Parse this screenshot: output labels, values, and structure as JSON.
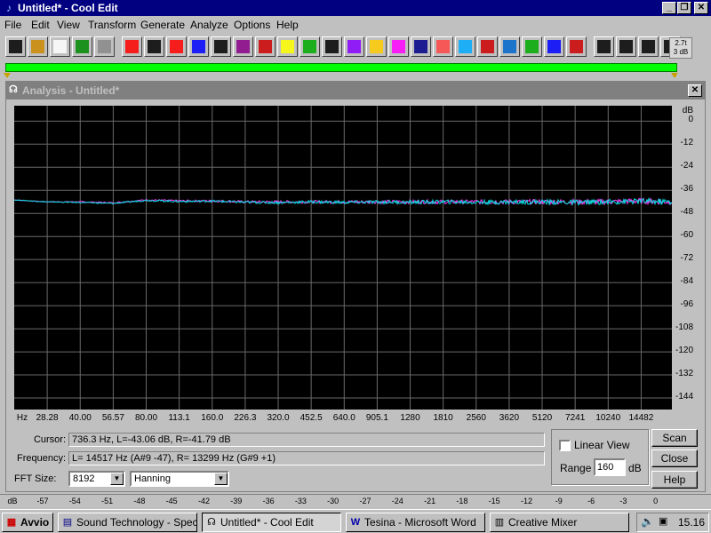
{
  "window": {
    "title": "Untitled* - Cool Edit",
    "buttons": [
      "_",
      "❐",
      "✕"
    ]
  },
  "menu": [
    "File",
    "Edit",
    "View",
    "Transform",
    "Generate",
    "Analyze",
    "Options",
    "Help"
  ],
  "toolbar": {
    "icons": [
      "edit-mode-icon",
      "open-icon",
      "new-icon",
      "save-icon",
      "headphones-icon",
      "rewind-icon",
      "stop-icon",
      "loop-icon",
      "note-icon",
      "record-icon",
      "envelope-icon",
      "fade-icon",
      "amplify-icon",
      "eq-icon",
      "timer-icon",
      "stereo-icon",
      "folder-icon",
      "spectral-icon",
      "invert-icon",
      "wave-icon",
      "spectrum-icon",
      "noise-icon",
      "filter-icon",
      "reverb-icon",
      "flange-icon",
      "pitch-icon",
      "mark1-icon",
      "mark2-icon",
      "mark3-icon",
      "mark4-icon"
    ],
    "level_lines": [
      "2.7t",
      "3 dB"
    ]
  },
  "analysis": {
    "title": "Analysis - Untitled*",
    "y_unit": "dB",
    "y_ticks": [
      "0",
      "-12",
      "-24",
      "-36",
      "-48",
      "-60",
      "-72",
      "-84",
      "-96",
      "-108",
      "-120",
      "-132",
      "-144"
    ],
    "x_unit": "Hz",
    "x_ticks": [
      "28.28",
      "40.00",
      "56.57",
      "80.00",
      "113.1",
      "160.0",
      "226.3",
      "320.0",
      "452.5",
      "640.0",
      "905.1",
      "1280",
      "1810",
      "2560",
      "3620",
      "5120",
      "7241",
      "10240",
      "14482"
    ],
    "cursor_label": "Cursor:",
    "cursor_value": "736.3 Hz, L=-43.06 dB, R=-41.79 dB",
    "frequency_label": "Frequency:",
    "frequency_value": "L=  14517 Hz (A#9 -47), R=  13299 Hz (G#9 +1)",
    "fft_label": "FFT Size:",
    "fft_value": "8192",
    "window_value": "Hanning",
    "linear_view_label": "Linear View",
    "range_label": "Range",
    "range_value": "160",
    "range_unit": "dB",
    "buttons": {
      "scan": "Scan",
      "close": "Close",
      "help": "Help"
    }
  },
  "chart_data": {
    "type": "line",
    "ylabel": "dB",
    "xlabel": "Hz",
    "ylim": [
      -150,
      8
    ],
    "x_scale": "log",
    "grid": true,
    "series": [
      {
        "color": "#ff40ff",
        "x": [
          20,
          28.28,
          40,
          56.57,
          80,
          113.1,
          160,
          226.3,
          320,
          452.5,
          640,
          905.1,
          1280,
          1810,
          2560,
          3620,
          5120,
          7241,
          10240,
          14482,
          20000
        ],
        "values": [
          -41,
          -42,
          -42,
          -42.5,
          -41,
          -41.5,
          -41.5,
          -42,
          -42,
          -42,
          -42,
          -42,
          -42,
          -42,
          -42,
          -42,
          -42,
          -42,
          -42,
          -41.5,
          -42
        ]
      },
      {
        "color": "#00e0e0",
        "x": [
          20,
          28.28,
          40,
          56.57,
          80,
          113.1,
          160,
          226.3,
          320,
          452.5,
          640,
          905.1,
          1280,
          1810,
          2560,
          3620,
          5120,
          7241,
          10240,
          14482,
          20000
        ],
        "values": [
          -41,
          -42,
          -42.3,
          -42.8,
          -41.2,
          -41.8,
          -41.6,
          -42.2,
          -42.4,
          -42,
          -42.3,
          -42.1,
          -42.2,
          -42,
          -42.2,
          -42.1,
          -42,
          -42.3,
          -42,
          -41.7,
          -42
        ]
      }
    ]
  },
  "db_meter": {
    "unit": "dB",
    "ticks": [
      "-57",
      "-54",
      "-51",
      "-48",
      "-45",
      "-42",
      "-39",
      "-36",
      "-33",
      "-30",
      "-27",
      "-24",
      "-21",
      "-18",
      "-15",
      "-12",
      "-9",
      "-6",
      "-3",
      "0"
    ]
  },
  "taskbar": {
    "start": "Avvio",
    "tasks": [
      "Sound Technology - Spec...",
      "Untitled* - Cool Edit",
      "Tesina - Microsoft Word",
      "Creative Mixer"
    ],
    "clock": "15.16"
  }
}
